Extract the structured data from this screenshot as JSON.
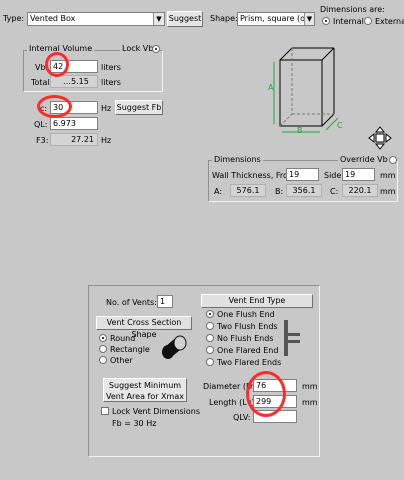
{
  "top": {
    "type_label": "Type:",
    "type_value": "Vented Box",
    "suggest_label": "Suggest",
    "shape_label": "Shape:",
    "shape_value": "Prism, square (opt.)",
    "dimensions_are_label": "Dimensions are:",
    "units_internal": "Internal",
    "units_external": "External"
  },
  "volume": {
    "group_title": "Internal Volume",
    "lock_vb_label": "Lock Vb",
    "vb_label": "Vb:",
    "vb_value": "42",
    "vb_unit": "liters",
    "total_label": "Total:",
    "total_value": "…5.15",
    "total_unit": "liters"
  },
  "tuning": {
    "fb_label": "c:",
    "fb_value": "30",
    "fb_unit": "Hz",
    "suggest_fb_label": "Suggest Fb",
    "ql_label": "QL:",
    "ql_value": "6.973",
    "f3_label": "F3:",
    "f3_value": "27.21",
    "f3_unit": "Hz"
  },
  "box_diagram": {
    "edge_a": "A",
    "edge_b": "B",
    "edge_c": "C"
  },
  "dimensions": {
    "group_title": "Dimensions",
    "override_label": "Override Vb",
    "wall_label": "Wall Thickness, Front:",
    "wall_front_value": "19",
    "side_label": "Side:",
    "wall_side_value": "19",
    "mm": "mm",
    "a_label": "A:",
    "a_value": "576.1",
    "b_label": "B:",
    "b_value": "356.1",
    "c_label": "C:",
    "c_value": "220.1"
  },
  "vent": {
    "num_vents_label": "No. of Vents:",
    "num_vents_value": "1",
    "cross_section_title": "Vent Cross Section Shape",
    "shape_options": [
      "Round",
      "Rectangle",
      "Other"
    ],
    "end_type_title": "Vent End Type",
    "end_options": [
      "One Flush End",
      "Two Flush Ends",
      "No Flush Ends",
      "One Flared End",
      "Two Flared Ends"
    ],
    "suggest_min_line1": "Suggest Minimum",
    "suggest_min_line2": "Vent Area for Xmax",
    "lock_dims_label": "Lock Vent Dimensions",
    "fb_note": "Fb = 30 Hz",
    "diameter_label": "Diameter (Dv):",
    "diameter_value": "76",
    "length_label": "Length (Lv):",
    "length_value": "299",
    "qlv_label": "QLV:",
    "mm": "mm"
  },
  "colors": {
    "background": "#c8c8c8",
    "diagram_green": "#1fa83c",
    "annotation_red": "#ff2b2b"
  }
}
